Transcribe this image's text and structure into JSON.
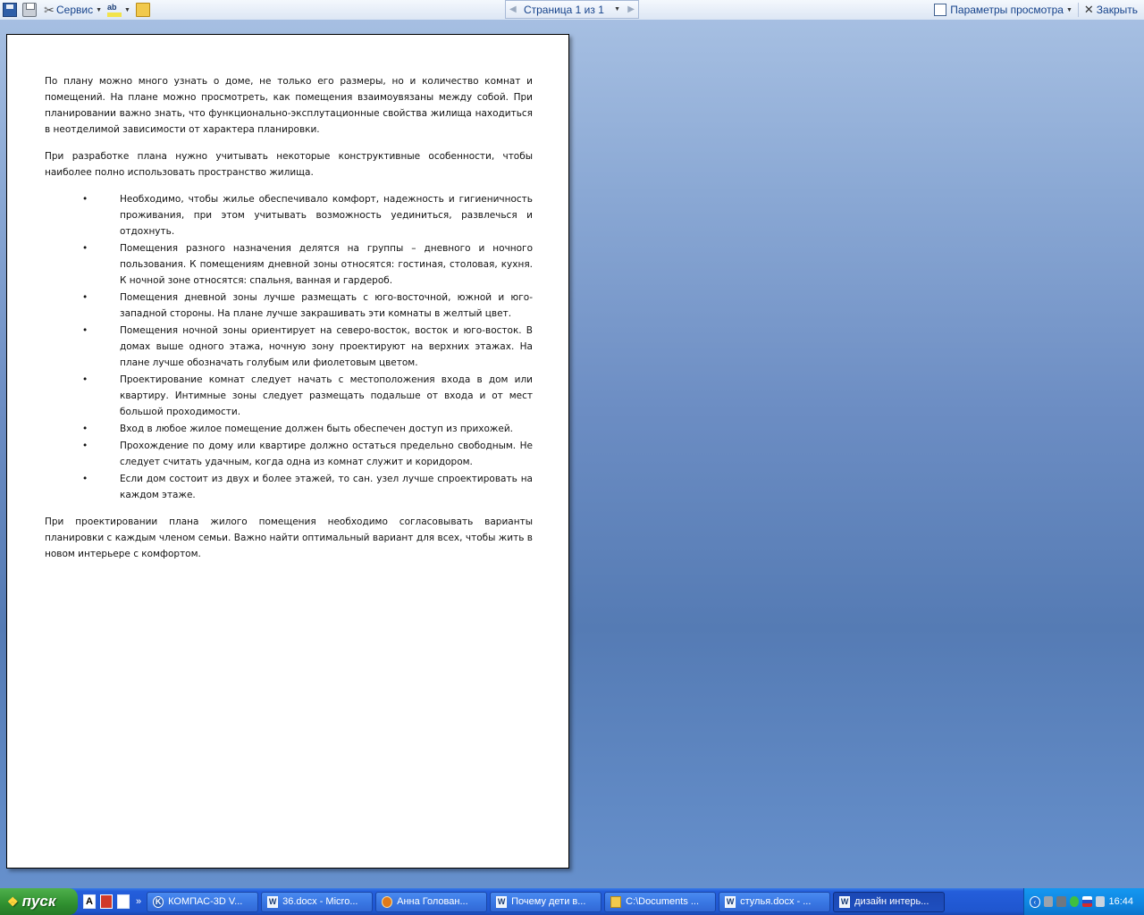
{
  "toolbar": {
    "service_label": "Сервис",
    "page_indicator": "Страница 1 из 1",
    "view_options_label": "Параметры просмотра",
    "close_label": "Закрыть",
    "spell_icon_text": "ab"
  },
  "document": {
    "para1": "По плану можно много узнать о доме, не только его размеры, но и количество комнат и помещений. На плане можно просмотреть, как помещения взаимоувязаны между собой. При планировании важно знать, что функционально-эксплутационные свойства жилища находиться в неотделимой зависимости от характера планировки.",
    "para2": "При разработке плана нужно учитывать некоторые конструктивные особенности, чтобы наиболее полно использовать пространство жилища.",
    "bullet_symbol": "•",
    "bullets": [
      "Необходимо, чтобы жилье обеспечивало комфорт, надежность и гигиеничность проживания, при этом учитывать возможность уединиться, развлечься и отдохнуть.",
      "Помещения разного назначения делятся на группы – дневного и ночного пользования. К помещениям дневной зоны относятся: гостиная, столовая, кухня. К ночной зоне относятся: спальня, ванная и гардероб.",
      "Помещения дневной зоны лучше размещать с юго-восточной, южной и юго-западной стороны. На плане лучше закрашивать эти комнаты в желтый цвет.",
      "Помещения ночной зоны ориентирует на северо-восток, восток и юго-восток. В домах выше одного этажа, ночную зону проектируют на верхних этажах. На плане лучше обозначать голубым или фиолетовым цветом.",
      "Проектирование комнат следует начать с местоположения входа в дом или квартиру. Интимные зоны следует размещать подальше от входа и от мест большой проходимости.",
      "Вход в любое жилое помещение  должен быть обеспечен доступ из прихожей.",
      "Прохождение по дому или квартире должно остаться предельно свободным. Не следует считать удачным, когда одна из комнат служит и коридором.",
      "Если дом состоит из двух и более этажей, то сан. узел лучше спроектировать на каждом этаже."
    ],
    "para3": "При проектировании плана жилого помещения необходимо согласовывать варианты планировки с каждым членом семьи. Важно найти оптимальный вариант  для всех, чтобы жить в новом интерьере с комфортом."
  },
  "taskbar": {
    "start_label": "пуск",
    "quick_launch_text": "A",
    "more_glyph": "»",
    "tasks": [
      {
        "label": "КОМПАС-3D V...",
        "icon": "kompas-icon"
      },
      {
        "label": "36.docx - Micro...",
        "icon": "word-icon"
      },
      {
        "label": "Анна Голован...",
        "icon": "firefox-icon"
      },
      {
        "label": "Почему дети в...",
        "icon": "word-icon"
      },
      {
        "label": "C:\\Documents ...",
        "icon": "folder-icon"
      },
      {
        "label": "стулья.docx - ...",
        "icon": "word-icon"
      },
      {
        "label": "дизайн интерь...",
        "icon": "word-icon",
        "active": true
      }
    ],
    "clock": "16:44"
  },
  "colors": {
    "taskbar_blue": "#245edb",
    "start_green": "#2f8f2f",
    "tray_blue": "#0f86e1",
    "toolbar_text": "#15428b"
  }
}
